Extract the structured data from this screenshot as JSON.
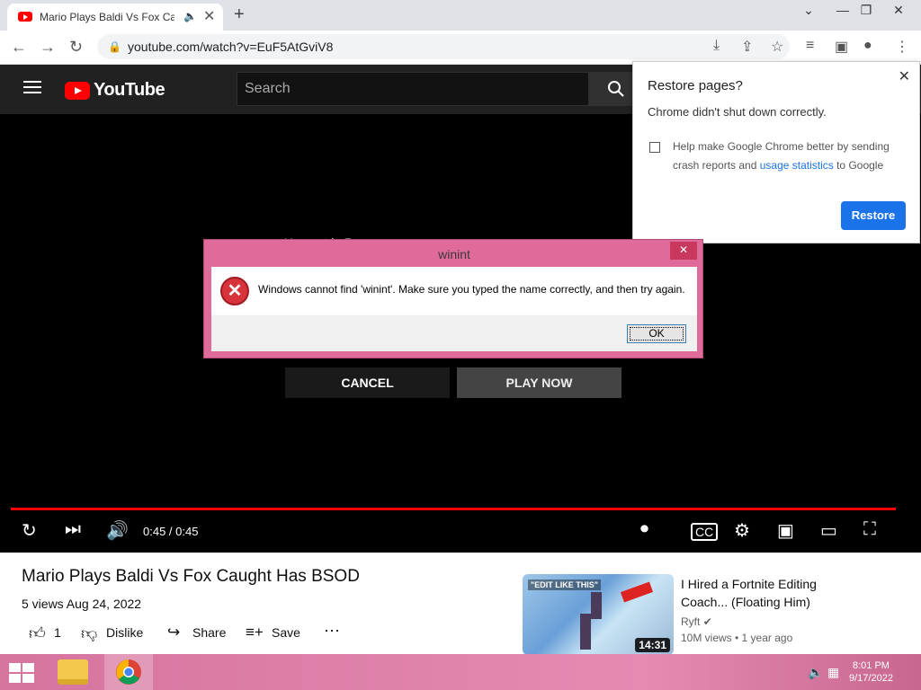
{
  "browser": {
    "tab_title": "Mario Plays Baldi Vs Fox Caught Has BSOD - YouTube",
    "tab_title_visible": "Mario Plays Baldi Vs Fox Cau",
    "url": "youtube.com/watch?v=EuF5AtGviV8"
  },
  "youtube": {
    "logo": "YouTube",
    "search_placeholder": "Search"
  },
  "player": {
    "upnext_text": "Up next in 7",
    "cancel_label": "CANCEL",
    "playnow_label": "PLAY NOW",
    "timecode": "0:45 / 0:45",
    "progress": 1.0
  },
  "restore_popup": {
    "title": "Restore pages?",
    "message": "Chrome didn't shut down correctly.",
    "checkbox_line1": "Help make Google Chrome better by sending",
    "checkbox_line2_pre": "crash reports and ",
    "checkbox_link": "usage statistics",
    "checkbox_line2_post": " to Google",
    "restore_label": "Restore",
    "close": "✕"
  },
  "error_dialog": {
    "title": "winint",
    "message": "Windows cannot find 'winint'. Make sure you typed the name correctly, and then try again.",
    "ok_label": "OK",
    "close": "✕"
  },
  "video": {
    "title": "Mario Plays Baldi Vs Fox Caught Has BSOD",
    "meta": "5 views  Aug 24, 2022",
    "likes": "1",
    "dislike_label": "Dislike",
    "share_label": "Share",
    "save_label": "Save"
  },
  "recommendation": {
    "title": "I Hired a Fortnite Editing Coach... (Floating Him)",
    "channel": "Ryft",
    "views": "10M views • 1 year ago",
    "duration": "14:31",
    "thumb_caption": "\"EDIT LIKE THIS\""
  },
  "taskbar": {
    "time": "8:01 PM",
    "date": "9/17/2022"
  },
  "colors": {
    "youtube_red": "#ff0000",
    "chrome_blue": "#1a73e8",
    "taskbar_pink": "#e58bb2"
  }
}
